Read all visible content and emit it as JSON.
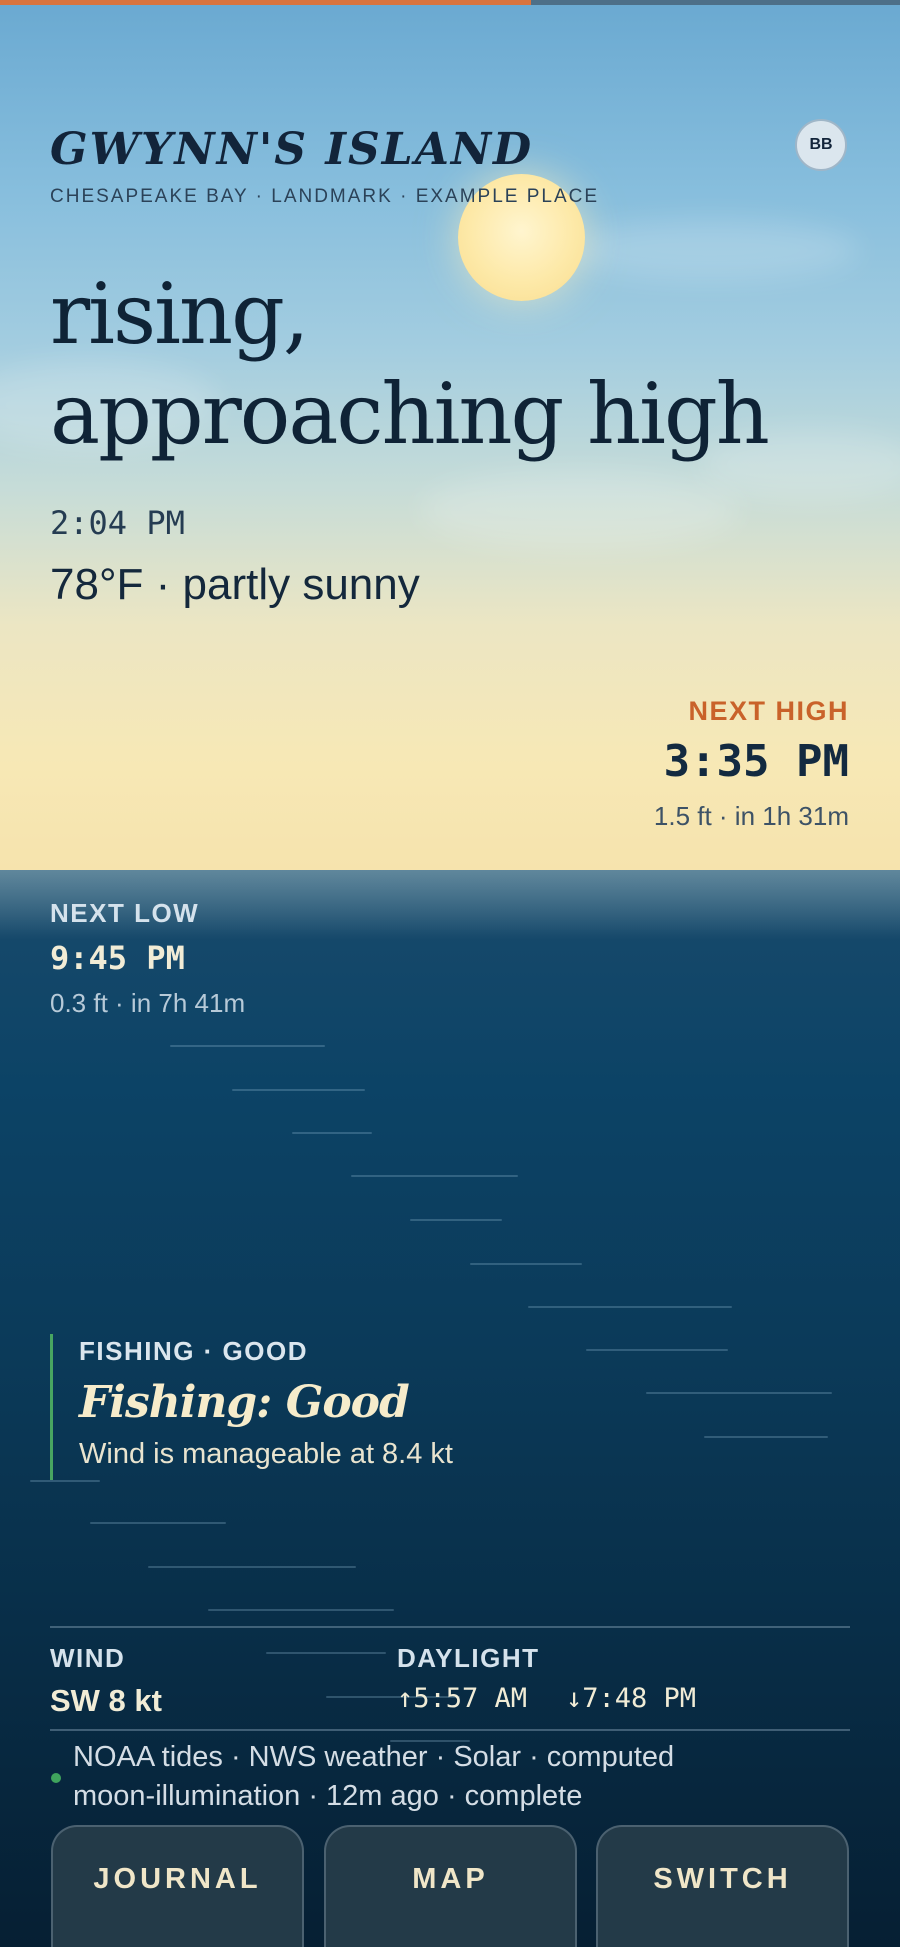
{
  "progress": {
    "value_fraction": 0.59,
    "fill_color": "#d9743e",
    "track_color": "#4d6f88"
  },
  "header": {
    "title": "GWYNN'S ISLAND",
    "subtitle": "CHESAPEAKE BAY · LANDMARK · EXAMPLE PLACE",
    "avatar_initials": "BB"
  },
  "hero": {
    "headline_line1": "rising,",
    "headline_line2": "approaching high",
    "time": "2:04 PM",
    "weather": "78°F · partly sunny"
  },
  "next_high": {
    "label": "NEXT HIGH",
    "time": "3:35 PM",
    "detail": "1.5 ft · in 1h 31m",
    "accent_color": "#c9622a"
  },
  "next_low": {
    "label": "NEXT LOW",
    "time": "9:45 PM",
    "detail": "0.3 ft · in 7h 41m"
  },
  "fishing": {
    "label": "FISHING · GOOD",
    "title": "Fishing: Good",
    "description": "Wind is manageable at 8.4 kt",
    "accent_color": "#48a561"
  },
  "stats": {
    "wind_label": "WIND",
    "wind_value": "SW 8 kt",
    "daylight_label": "DAYLIGHT",
    "sunrise": "↑5:57 AM",
    "sunset": "↓7:48 PM"
  },
  "status": {
    "line1": "NOAA tides · NWS weather · Solar · computed",
    "line2": "moon-illumination · 12m ago · complete",
    "dot_color": "#3fa45d"
  },
  "buttons": {
    "journal": "JOURNAL",
    "map": "MAP",
    "switch": "SWITCH"
  },
  "icons": {
    "sun": "sun-icon",
    "status": "status-dot-icon"
  }
}
